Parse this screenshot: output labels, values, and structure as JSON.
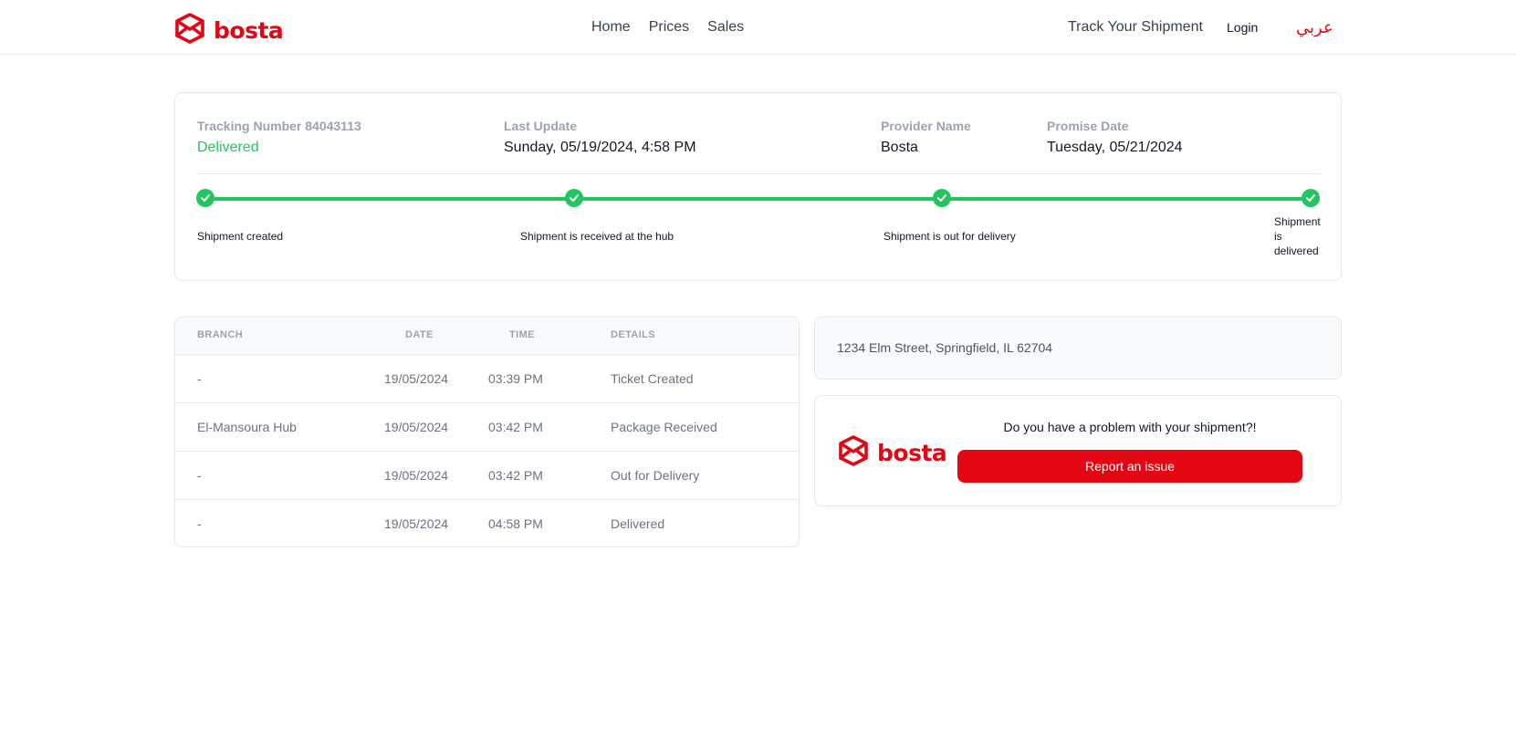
{
  "header": {
    "logo_text": "bosta",
    "nav": [
      {
        "label": "Home"
      },
      {
        "label": "Prices"
      },
      {
        "label": "Sales"
      }
    ],
    "track_label": "Track Your Shipment",
    "login_label": "Login",
    "language_label": "عربي"
  },
  "summary": {
    "tracking_label": "Tracking Number 84043113",
    "status": "Delivered",
    "last_update_label": "Last Update",
    "last_update_value": "Sunday, 05/19/2024, 4:58 PM",
    "provider_label": "Provider Name",
    "provider_value": "Bosta",
    "promise_label": "Promise Date",
    "promise_value": "Tuesday, 05/21/2024",
    "progress_fraction": 1.0,
    "steps": [
      {
        "label": "Shipment created"
      },
      {
        "label": "Shipment is received at the hub"
      },
      {
        "label": "Shipment is out for delivery"
      },
      {
        "label": "Shipment is delivered"
      }
    ]
  },
  "events": {
    "headers": {
      "branch": "BRANCH",
      "date": "DATE",
      "time": "TIME",
      "details": "DETAILS"
    },
    "rows": [
      {
        "branch": "-",
        "date": "19/05/2024",
        "time": "03:39 PM",
        "details": "Ticket Created"
      },
      {
        "branch": "El-Mansoura Hub",
        "date": "19/05/2024",
        "time": "03:42 PM",
        "details": "Package Received"
      },
      {
        "branch": "-",
        "date": "19/05/2024",
        "time": "03:42 PM",
        "details": "Out for Delivery"
      },
      {
        "branch": "-",
        "date": "19/05/2024",
        "time": "04:58 PM",
        "details": "Delivered"
      }
    ]
  },
  "address": {
    "text": "1234 Elm Street, Springfield, IL 62704"
  },
  "problem": {
    "logo_text": "bosta",
    "question": "Do you have a problem with your shipment?!",
    "button_label": "Report an issue"
  },
  "colors": {
    "brand": "#e30613",
    "success": "#22c55e"
  }
}
